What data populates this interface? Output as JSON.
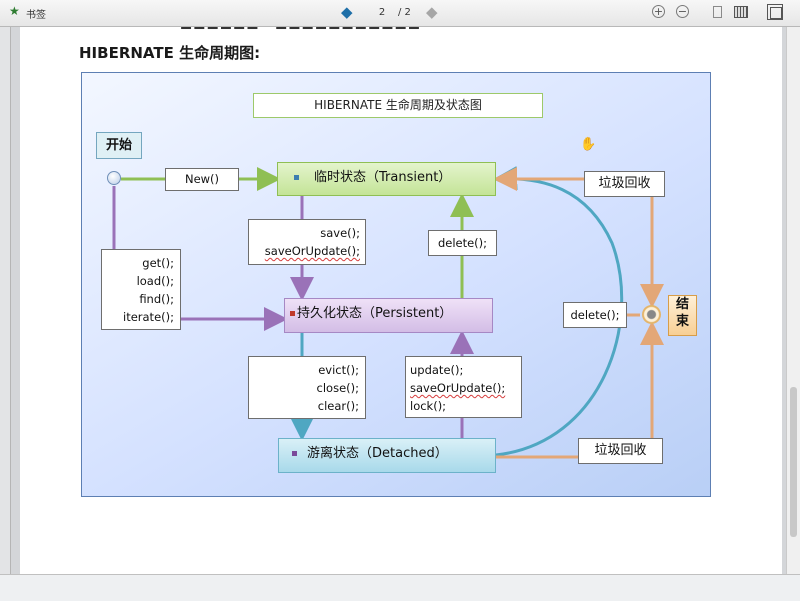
{
  "toolbar": {
    "bookmark_label": "书签",
    "current_page": "2",
    "total_pages": "/ 2",
    "icons": [
      "bookmark-icon",
      "prev-page-icon",
      "next-page-icon",
      "zoom-in-icon",
      "zoom-out-icon",
      "single-page-view-icon",
      "two-page-view-icon",
      "fullscreen-icon"
    ]
  },
  "document": {
    "section_title": "HIBERNATE 生命周期图:",
    "figure": {
      "title": "HIBERNATE 生命周期及状态图",
      "start_label": "开始",
      "end_label": [
        "结",
        "束"
      ],
      "states": {
        "transient": "临时状态（Transient）",
        "persistent": "持久化状态（Persistent）",
        "detached": "游离状态（Detached）"
      },
      "transitions": {
        "new": "New()",
        "save": [
          "save();",
          "saveOrUpdate();"
        ],
        "delete_to_transient": "delete();",
        "get": [
          "get();",
          "load();",
          "find();",
          "iterate();"
        ],
        "evict": [
          "evict();",
          "close();",
          "clear();"
        ],
        "update": [
          "update();",
          "saveOrUpdate();",
          "lock();"
        ],
        "delete_right": "delete();",
        "gc_top": "垃圾回收",
        "gc_bottom": "垃圾回收"
      },
      "colors": {
        "green_arrow": "#8fbf54",
        "purple_arrow": "#9a72b8",
        "teal_arrow": "#4fa7c2",
        "orange_arrow": "#e3a777",
        "transient_fill": "#c4e497",
        "persistent_fill": "#d3bde6",
        "detached_fill": "#a8d9ea"
      }
    }
  }
}
